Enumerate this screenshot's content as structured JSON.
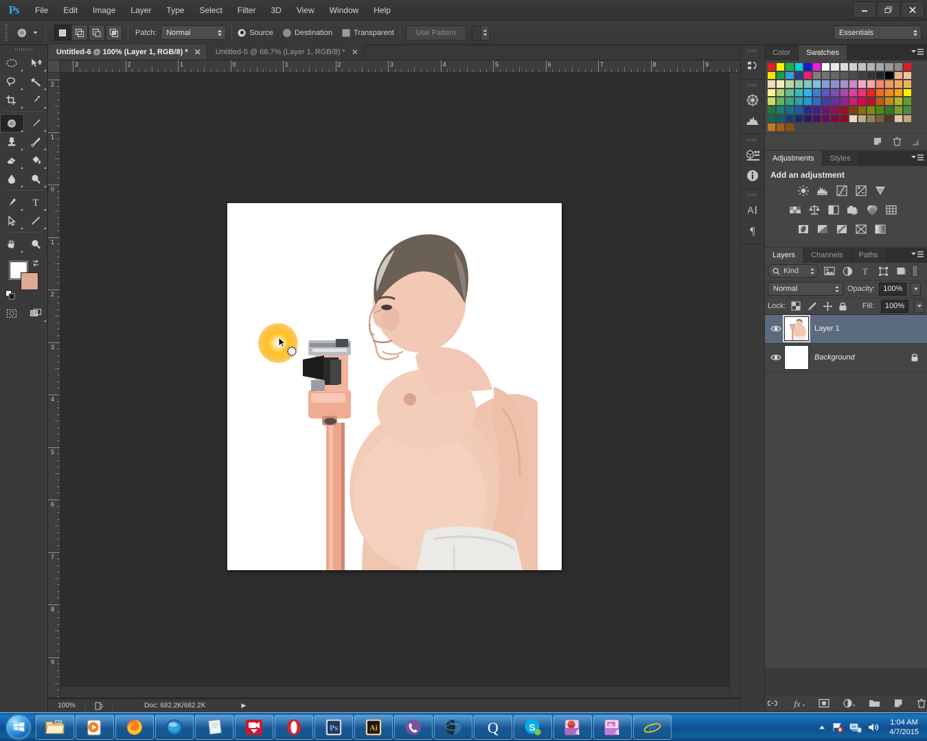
{
  "app": {
    "name": "Adobe Photoshop CS6",
    "logo": "Ps"
  },
  "menubar": {
    "items": [
      {
        "label": "File"
      },
      {
        "label": "Edit"
      },
      {
        "label": "Image"
      },
      {
        "label": "Layer"
      },
      {
        "label": "Type"
      },
      {
        "label": "Select"
      },
      {
        "label": "Filter"
      },
      {
        "label": "3D"
      },
      {
        "label": "View"
      },
      {
        "label": "Window"
      },
      {
        "label": "Help"
      }
    ],
    "window_controls": {
      "minimize": "–",
      "restore": "❐",
      "close": "✕"
    }
  },
  "optionsbar": {
    "tool": "patch-tool",
    "patch_label": "Patch:",
    "patch_mode": "Normal",
    "source_label": "Source",
    "destination_label": "Destination",
    "transparent_label": "Transparent",
    "use_pattern_label": "Use Pattern",
    "source_selected": true,
    "destination_selected": false,
    "transparent_checked": false,
    "use_pattern_enabled": false
  },
  "workspace": {
    "selected": "Essentials"
  },
  "tools": [
    {
      "name": "rectangular-marquee-tool",
      "glyph": "marquee"
    },
    {
      "name": "move-tool",
      "glyph": "move"
    },
    {
      "name": "lasso-tool",
      "glyph": "lasso"
    },
    {
      "name": "magic-wand-tool",
      "glyph": "wand"
    },
    {
      "name": "crop-tool",
      "glyph": "crop"
    },
    {
      "name": "eyedropper-tool",
      "glyph": "eyedropper"
    },
    {
      "name": "patch-tool",
      "glyph": "patch",
      "selected": true
    },
    {
      "name": "brush-tool",
      "glyph": "brush"
    },
    {
      "name": "clone-stamp-tool",
      "glyph": "stamp"
    },
    {
      "name": "history-brush-tool",
      "glyph": "historybrush"
    },
    {
      "name": "eraser-tool",
      "glyph": "eraser"
    },
    {
      "name": "gradient-tool",
      "glyph": "paintbucket"
    },
    {
      "name": "blur-tool",
      "glyph": "blur"
    },
    {
      "name": "dodge-tool",
      "glyph": "dodge"
    },
    {
      "name": "pen-tool",
      "glyph": "pen"
    },
    {
      "name": "type-tool",
      "glyph": "type"
    },
    {
      "name": "path-selection-tool",
      "glyph": "pathselect"
    },
    {
      "name": "line-tool",
      "glyph": "line"
    },
    {
      "name": "hand-tool",
      "glyph": "hand"
    },
    {
      "name": "zoom-tool",
      "glyph": "zoom"
    }
  ],
  "colors": {
    "foreground": "#fdfdfb",
    "background": "#dda894",
    "panel_bg": "#454545",
    "chrome_bg": "#3a3a3a",
    "selection_blue": "#5b6b7d",
    "accent_blue": "#2fa8e0",
    "taskbar_blue": "#1a74bd",
    "cursor_highlight": "#f5b60f"
  },
  "document_tabs": [
    {
      "label": "Untitled-6 @ 100% (Layer 1, RGB/8) *",
      "active": true,
      "close": "✕"
    },
    {
      "label": "Untitled-5 @ 66.7% (Layer 1, RGB/8) *",
      "active": false,
      "close": "✕"
    }
  ],
  "rulers": {
    "unit": "inches",
    "horizontal_labels": [
      "3",
      "2",
      "1",
      "0",
      "1",
      "2",
      "3",
      "4",
      "5",
      "6",
      "7",
      "8",
      "9"
    ],
    "vertical_labels": [
      "2",
      "1",
      "0",
      "1",
      "2",
      "3",
      "4",
      "5",
      "6",
      "7",
      "8",
      "9"
    ]
  },
  "statusbar": {
    "zoom": "100%",
    "doc_info": "Doc: 682.2K/682.2K",
    "arrow": "▶"
  },
  "dock_icons": [
    {
      "name": "history-icon"
    },
    {
      "name": "navigator-icon"
    },
    {
      "name": "histogram-icon"
    },
    {
      "name": "3d-icon"
    },
    {
      "name": "info-icon"
    },
    {
      "name": "character-icon"
    },
    {
      "name": "paragraph-icon"
    }
  ],
  "color_panel": {
    "tabs": [
      {
        "label": "Color",
        "active": false
      },
      {
        "label": "Swatches",
        "active": true
      }
    ],
    "swatch_rows": [
      [
        "#ec1c24",
        "#fff200",
        "#22b14c",
        "#00d4d4",
        "#1a18d0",
        "#ee1ce0",
        "#ffffff",
        "#e9e9e9",
        "#dcdcdc",
        "#cfcfcf",
        "#c2c2c2",
        "#b4b4b4",
        "#a7a7a7",
        "#9a9a9a",
        "#8d8d8d",
        "#e01b22"
      ],
      [
        "#f7e500",
        "#1b9e4b",
        "#2f9fe0",
        "#2b3894",
        "#ef1e70",
        "#808080",
        "#737373",
        "#666666",
        "#595959",
        "#4d4d4d",
        "#404040",
        "#333333",
        "#262626",
        "#000000",
        "#f6b187",
        "#f6c4a3"
      ],
      [
        "#f3dcb9",
        "#f2edb3",
        "#bcd8a0",
        "#8ecbae",
        "#7fc9bd",
        "#7fc1e2",
        "#7f9fd8",
        "#8f8fd0",
        "#a98fd0",
        "#c48ccb",
        "#f3a8c4",
        "#f8a9ab",
        "#f4896b",
        "#f09a5e",
        "#f0a95e",
        "#f0b05e"
      ],
      [
        "#fbf38d",
        "#aed07a",
        "#63bf8e",
        "#36bdbd",
        "#34b4e8",
        "#3f7fd4",
        "#5a5ac6",
        "#7d4fb8",
        "#a94bb0",
        "#e04196",
        "#f2307a",
        "#ee2424",
        "#ef6b1d",
        "#f08a1d",
        "#f6a41c",
        "#fff200"
      ],
      [
        "#c8dd5b",
        "#5bb85b",
        "#35a87f",
        "#22a3b3",
        "#1e9ae0",
        "#2c6ecb",
        "#3f3fb3",
        "#6c2fa8",
        "#9a1f9a",
        "#d01b7a",
        "#e5004f",
        "#c01020",
        "#c05a10",
        "#c78a12",
        "#b7b517",
        "#5f9e2f"
      ],
      [
        "#1f7a3f",
        "#17806e",
        "#156f8c",
        "#1a5aa8",
        "#232c8c",
        "#451f85",
        "#6b1478",
        "#8c0f5a",
        "#9b0d28",
        "#8c3a0d",
        "#8c6d0c",
        "#7f8c0b",
        "#4f8c0b",
        "#2f7a1f",
        "#7f9f2f",
        "#4f8c3f"
      ],
      [
        "#14694a",
        "#155c6b",
        "#153f7a",
        "#1a2a6b",
        "#2d1763",
        "#451363",
        "#63105a",
        "#7a0c3f",
        "#8c0b1f",
        "#e8dcc0",
        "#c0a888",
        "#9b7f5a",
        "#7a5f3a",
        "#4f3a22",
        "#e3c9a3",
        "#caa478"
      ],
      [
        "#c07a22",
        "#a05f1a",
        "#8c4f14",
        "#454545",
        "#454545",
        "#454545",
        "#454545",
        "#454545",
        "#454545",
        "#454545",
        "#454545",
        "#454545",
        "#454545",
        "#454545",
        "#454545",
        "#454545"
      ]
    ],
    "footer_icons": [
      {
        "name": "new-swatch-icon"
      },
      {
        "name": "delete-swatch-icon"
      },
      {
        "name": "resize-grip-icon"
      }
    ]
  },
  "adjustments_panel": {
    "tabs": [
      {
        "label": "Adjustments",
        "active": true
      },
      {
        "label": "Styles",
        "active": false
      }
    ],
    "title": "Add an adjustment",
    "rows": [
      [
        {
          "name": "brightness-contrast-icon"
        },
        {
          "name": "levels-icon"
        },
        {
          "name": "curves-icon"
        },
        {
          "name": "exposure-icon"
        },
        {
          "name": "vibrance-icon"
        }
      ],
      [
        {
          "name": "hue-saturation-icon"
        },
        {
          "name": "color-balance-icon"
        },
        {
          "name": "black-white-icon"
        },
        {
          "name": "photo-filter-icon"
        },
        {
          "name": "channel-mixer-icon"
        },
        {
          "name": "color-lookup-icon"
        }
      ],
      [
        {
          "name": "invert-icon"
        },
        {
          "name": "posterize-icon"
        },
        {
          "name": "threshold-icon"
        },
        {
          "name": "selective-color-icon"
        },
        {
          "name": "gradient-map-icon"
        }
      ]
    ]
  },
  "layers_panel": {
    "tabs": [
      {
        "label": "Layers",
        "active": true
      },
      {
        "label": "Channels",
        "active": false
      },
      {
        "label": "Paths",
        "active": false
      }
    ],
    "filter": {
      "kind_label": "Kind",
      "icons": [
        {
          "name": "filter-pixel-icon"
        },
        {
          "name": "filter-adjustment-icon"
        },
        {
          "name": "filter-type-icon"
        },
        {
          "name": "filter-shape-icon"
        },
        {
          "name": "filter-smart-object-icon"
        }
      ]
    },
    "blend_mode": "Normal",
    "opacity_label": "Opacity:",
    "opacity_value": "100%",
    "lock_label": "Lock:",
    "fill_label": "Fill:",
    "fill_value": "100%",
    "lock_icons": [
      {
        "name": "lock-transparent-pixels-icon"
      },
      {
        "name": "lock-image-pixels-icon"
      },
      {
        "name": "lock-position-icon"
      },
      {
        "name": "lock-all-icon"
      }
    ],
    "layers": [
      {
        "name": "Layer 1",
        "visible": true,
        "selected": true,
        "locked": false,
        "italic": false
      },
      {
        "name": "Background",
        "visible": true,
        "selected": false,
        "locked": true,
        "italic": true
      }
    ],
    "footer_icons": [
      {
        "name": "link-layers-icon"
      },
      {
        "name": "layer-style-icon"
      },
      {
        "name": "add-layer-mask-icon"
      },
      {
        "name": "new-adjustment-layer-icon"
      },
      {
        "name": "new-group-icon"
      },
      {
        "name": "new-layer-icon"
      },
      {
        "name": "delete-layer-icon"
      }
    ]
  },
  "canvas": {
    "cursor_tool": "patch-tool-cursor",
    "click_highlight": true,
    "image_description": "photo of overweight man standing beside medical scale"
  },
  "taskbar": {
    "start_button": "start-orb",
    "items": [
      {
        "name": "windows-explorer",
        "glyph": "folder"
      },
      {
        "name": "windows-media-player",
        "glyph": "media"
      },
      {
        "name": "mozilla-firefox",
        "glyph": "firefox"
      },
      {
        "name": "browser-blue",
        "glyph": "globe-blue"
      },
      {
        "name": "notepad",
        "glyph": "notepad"
      },
      {
        "name": "screen-recorder",
        "glyph": "camcorder"
      },
      {
        "name": "opera",
        "glyph": "opera"
      },
      {
        "name": "adobe-photoshop",
        "glyph": "ps",
        "label": "Ps",
        "active": true
      },
      {
        "name": "adobe-illustrator",
        "glyph": "ai",
        "label": "Ai"
      },
      {
        "name": "viber",
        "glyph": "viber"
      },
      {
        "name": "browser-dark",
        "glyph": "globe-dark"
      },
      {
        "name": "qbittorrent",
        "glyph": "q",
        "label": "Q"
      },
      {
        "name": "skype",
        "glyph": "skype",
        "label": "S"
      },
      {
        "name": "media-player-4",
        "glyph": "mp4a",
        "label": "4"
      },
      {
        "name": "media-player-4b",
        "glyph": "mp4b",
        "label": "4"
      },
      {
        "name": "internet-explorer",
        "glyph": "ie"
      }
    ],
    "tray": [
      {
        "name": "show-hidden-icons",
        "glyph": "caret-up"
      },
      {
        "name": "network-icon",
        "glyph": "network"
      },
      {
        "name": "action-center-icon",
        "glyph": "flag"
      },
      {
        "name": "volume-icon",
        "glyph": "speaker"
      }
    ],
    "clock": {
      "time": "1:04 AM",
      "date": "4/7/2015"
    }
  }
}
